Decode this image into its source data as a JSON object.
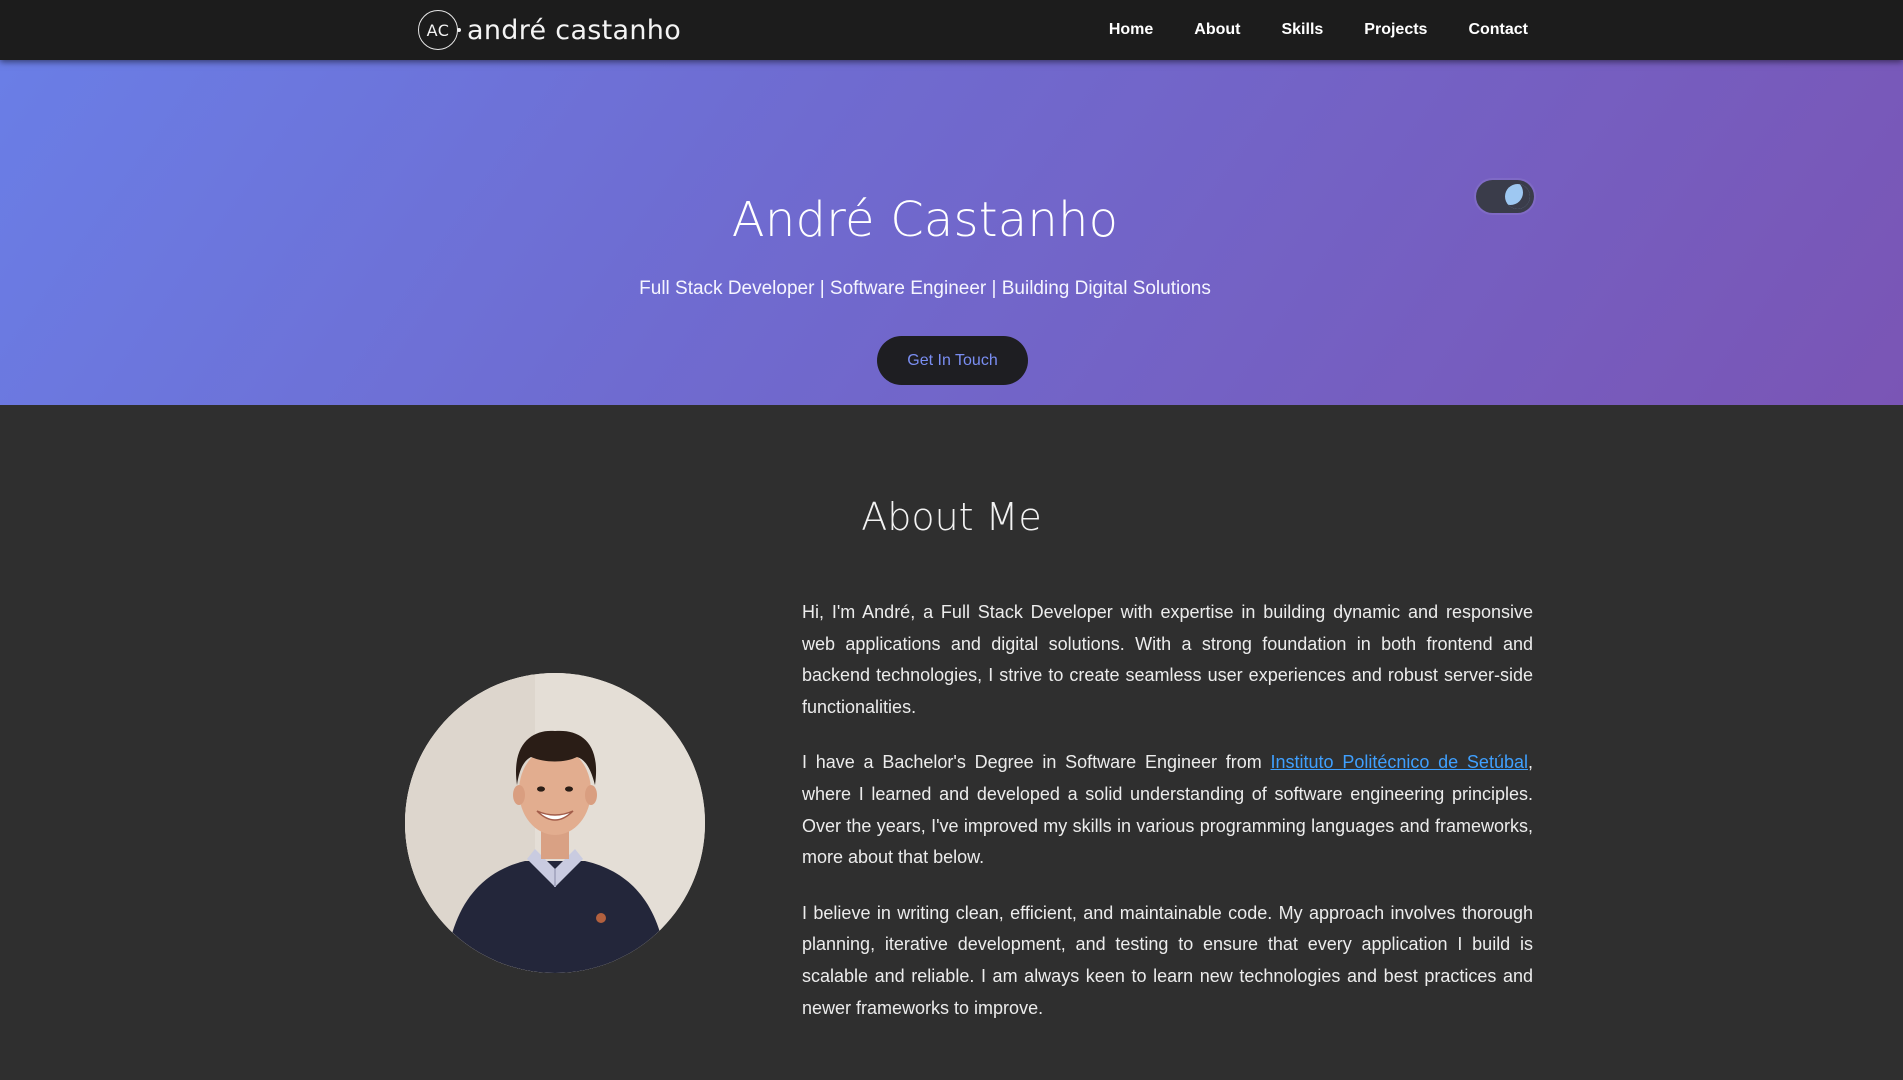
{
  "navbar": {
    "logo_mark": "AC",
    "brand_name": "andré castanho",
    "links": [
      "Home",
      "About",
      "Skills",
      "Projects",
      "Contact"
    ]
  },
  "hero": {
    "title": "André Castanho",
    "subtitle": "Full Stack Developer | Software Engineer | Building Digital Solutions",
    "cta_label": "Get In Touch",
    "theme_toggle_icon": "moon-icon"
  },
  "about": {
    "title": "About Me",
    "paragraph1": "Hi, I'm André, a Full Stack Developer with expertise in building dynamic and responsive web applications and digital solutions. With a strong foundation in both frontend and backend technologies, I strive to create seamless user experiences and robust server-side functionalities.",
    "paragraph2_before": "I have a Bachelor's Degree in Software Engineer from ",
    "paragraph2_link": "Instituto Politécnico de Setúbal",
    "paragraph2_after": ", where I learned and developed a solid understanding of software engineering principles. Over the years, I've improved my skills in various programming languages and frameworks, more about that below.",
    "paragraph3": "I believe in writing clean, efficient, and maintainable code. My approach involves thorough planning, iterative development, and testing to ensure that every application I build is scalable and reliable. I am always keen to learn new technologies and best practices and newer frameworks to improve."
  },
  "colors": {
    "navbar_bg": "#1c1c1c",
    "hero_gradient_start": "#6a7ee6",
    "hero_gradient_end": "#7a55b5",
    "page_bg": "#2f2f2f",
    "accent": "#7a8ef2",
    "link": "#3fa0ff"
  }
}
